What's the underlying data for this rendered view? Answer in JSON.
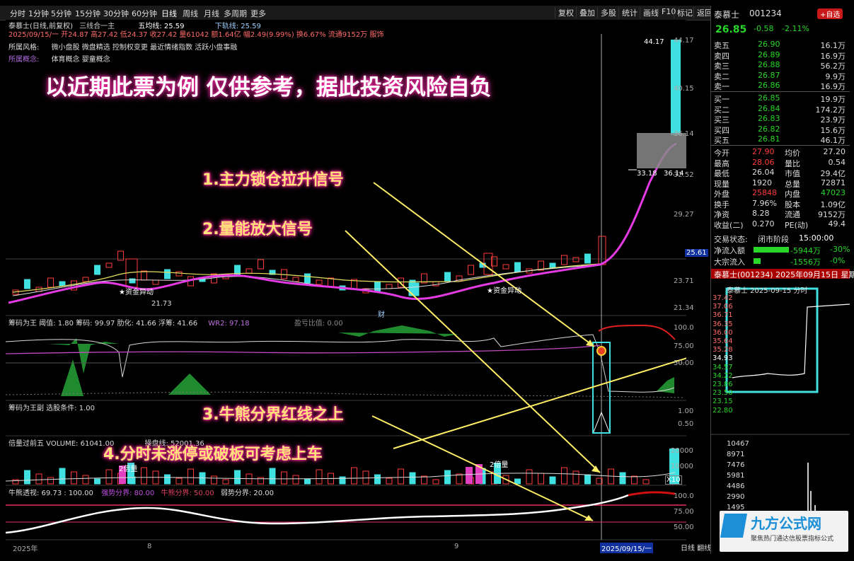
{
  "toolbar": {
    "tabs": [
      "分时",
      "1分钟",
      "5分钟",
      "15分钟",
      "30分钟",
      "60分钟",
      "日线",
      "周线",
      "月线",
      "多周期",
      "更多"
    ],
    "right_buttons": [
      "复权",
      "叠加",
      "多股",
      "统计",
      "画线",
      "F10",
      "标记",
      "返回"
    ]
  },
  "stock_header": {
    "title": "泰慕士(日线,前复权)",
    "mode": "三线合一主",
    "ma_label": "五均线: 25.59",
    "ma_label2": "下轨线: 25.59",
    "info_line": "2025/09/15/一 开24.87 高27.42 低24.37 收27.42 量61042 额1.64亿 幅2.49(9.99%) 换6.67% 流通9152万 服饰",
    "style_label": "所属风格:",
    "style_value": "微小盘股 微盘精选 控制权变更 最近情绪指数 活跃小盘事融",
    "concept_label": "所属概念:",
    "concept_value": "体育概念 婴童概念"
  },
  "headline": "以近期此票为例   仅供参考，据此投资风险自负",
  "annotations": {
    "a1": "1.主力锁仓拉升信号",
    "a2": "2.量能放大信号",
    "a3": "3.牛熊分界红线之上",
    "a4": "4.分时未涨停或破板可考虑上车"
  },
  "main_axis": [
    "44.17",
    "40.15",
    "36.14",
    "32.52",
    "29.27",
    "25.61",
    "23.71",
    "21.34"
  ],
  "main_marks": {
    "high_label": "44.17",
    "box_left": "33.18",
    "box_right": "36.14",
    "low_label": "21.73",
    "fund1": "资金异动",
    "fund2": "资金异动",
    "cai": "财"
  },
  "pane2": {
    "info": "筹码为王 阈值: 1.80 筹码: 99.97 肋化: 41.66 浮筹: 41.66",
    "wr": "WR2: 97.18",
    "ratio": "盈亏比值: 0.00",
    "axis": [
      "100.0",
      "75.00",
      "50.00"
    ]
  },
  "pane3": {
    "info": "筹码为王副 选股条件: 1.00",
    "axis": [
      "1.00",
      "0.50"
    ]
  },
  "pane4": {
    "info": "倍量过前五 VOLUME: 61041.00",
    "info2": "操盘线: 52001.36",
    "axis": [
      "20000",
      "10000"
    ],
    "mult": "X10",
    "tag1": "2倍量",
    "tag2": "2倍量"
  },
  "pane5": {
    "info": "牛熊透视: 69.73 : 100.00",
    "strong": "强势分界: 80.00",
    "bull": "牛熊分界: 50.00",
    "weak": "弱势分界: 20.00",
    "axis": [
      "100.0",
      "75.00",
      "50.00"
    ]
  },
  "xaxis": {
    "year": "2025年",
    "m8": "8",
    "m9": "9",
    "cursor": "2025/09/15/一",
    "footer": "日线 翻线 技线 专线 统计"
  },
  "quote": {
    "name": "泰慕士",
    "code": "001234",
    "badge": "+自选",
    "price": "26.85",
    "change": "-0.58",
    "pct": "-2.11%",
    "asks": [
      {
        "label": "卖五",
        "price": "26.90",
        "vol": "16.1万"
      },
      {
        "label": "卖四",
        "price": "26.89",
        "vol": "16.9万"
      },
      {
        "label": "卖三",
        "price": "26.88",
        "vol": "56.2万"
      },
      {
        "label": "卖二",
        "price": "26.87",
        "vol": "9.9万"
      },
      {
        "label": "卖一",
        "price": "26.86",
        "vol": "16.9万"
      }
    ],
    "bids": [
      {
        "label": "买一",
        "price": "26.85",
        "vol": "19.9万"
      },
      {
        "label": "买二",
        "price": "26.84",
        "vol": "174.2万"
      },
      {
        "label": "买三",
        "price": "26.83",
        "vol": "23.9万"
      },
      {
        "label": "买四",
        "price": "26.82",
        "vol": "15.6万"
      },
      {
        "label": "买五",
        "price": "26.81",
        "vol": "46.1万"
      }
    ],
    "stats": [
      {
        "l1": "今开",
        "v1": "27.90",
        "l2": "均价",
        "v2": "27.20"
      },
      {
        "l1": "最高",
        "v1": "28.06",
        "l2": "量比",
        "v2": "0.54"
      },
      {
        "l1": "最低",
        "v1": "26.04",
        "l2": "市值",
        "v2": "29.4亿"
      },
      {
        "l1": "现量",
        "v1": "1920",
        "l2": "总量",
        "v2": "72871"
      },
      {
        "l1": "外盘",
        "v1": "25848",
        "l2": "内盘",
        "v2": "47023"
      },
      {
        "l1": "换手",
        "v1": "7.96%",
        "l2": "股本",
        "v2": "1.09亿"
      },
      {
        "l1": "净资",
        "v1": "8.28",
        "l2": "流通",
        "v2": "9152万"
      },
      {
        "l1": "收益(二)",
        "v1": "0.270",
        "l2": "PE(动)",
        "v2": "49.4"
      }
    ],
    "trade_state_label": "交易状态:",
    "trade_state": "闭市阶段",
    "trade_time": "15:00:00",
    "flow1_label": "净流入额",
    "flow1_val": "-5944万",
    "flow1_pct": "-30%",
    "flow2_label": "大宗流入",
    "flow2_val": "-1556万",
    "flow2_pct": "-0%",
    "mini_title": "泰慕士(001234) 2025年09月15日 星期一",
    "mini_sub": "泰慕士  2025-09-15 分时",
    "mini_axis": [
      "37.42",
      "37.06",
      "36.71",
      "36.35",
      "36.00",
      "35.64",
      "35.28",
      "34.93",
      "34.57",
      "34.22",
      "23.86",
      "23.50",
      "23.15",
      "22.80"
    ],
    "vol_axis": [
      "10467",
      "8971",
      "7476",
      "5981",
      "4486",
      "2990",
      "1495"
    ],
    "logo": "九方公式网",
    "logo_sub": "聚焦热门通达信股票指标公式"
  },
  "colors": {
    "up": "#ff3b3b",
    "down": "#40e0e0",
    "ma": "#e040e0",
    "accent_yellow": "#ffe27a"
  }
}
